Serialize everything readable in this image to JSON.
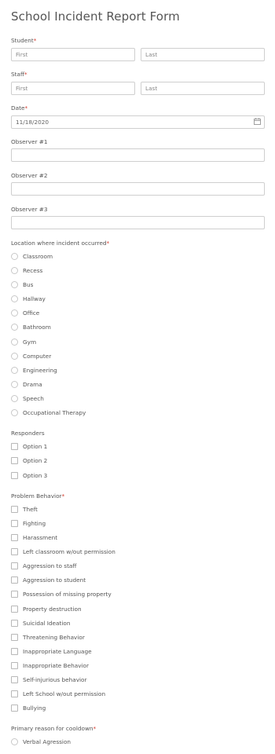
{
  "form": {
    "title": "School Incident Report Form",
    "required_mark": "*"
  },
  "student": {
    "label": "Student",
    "first_placeholder": "First",
    "last_placeholder": "Last"
  },
  "staff": {
    "label": "Staff",
    "first_placeholder": "First",
    "last_placeholder": "Last"
  },
  "date": {
    "label": "Date",
    "value": "11/18/2020",
    "icon": "calendar-icon"
  },
  "observers": [
    {
      "label": "Observer #1",
      "value": ""
    },
    {
      "label": "Observer #2",
      "value": ""
    },
    {
      "label": "Observer #3",
      "value": ""
    }
  ],
  "location": {
    "label": "Location where incident occurred",
    "options": [
      "Classroom",
      "Recess",
      "Bus",
      "Hallway",
      "Office",
      "Bathroom",
      "Gym",
      "Computer",
      "Engineering",
      "Drama",
      "Speech",
      "Occupational Therapy"
    ]
  },
  "responders": {
    "label": "Responders",
    "options": [
      "Option 1",
      "Option 2",
      "Option 3"
    ]
  },
  "problem_behavior": {
    "label": "Problem Behavior",
    "options": [
      "Theft",
      "Fighting",
      "Harassment",
      "Left classroom w/out permission",
      "Aggression to staff",
      "Aggression to student",
      "Possession of missing property",
      "Property destruction",
      "Suicidal Ideation",
      "Threatening Behavior",
      "Inappropriate Language",
      "Inappropriate Behavior",
      "Self-injurious behavior",
      "Left School w/out permission",
      "Bullying"
    ]
  },
  "cooldown": {
    "label": "Primary reason for cooldown",
    "options": [
      "Verbal Agression"
    ]
  },
  "colors": {
    "required": "#d33a2c",
    "border": "#cfcfcf",
    "text": "#555555"
  }
}
